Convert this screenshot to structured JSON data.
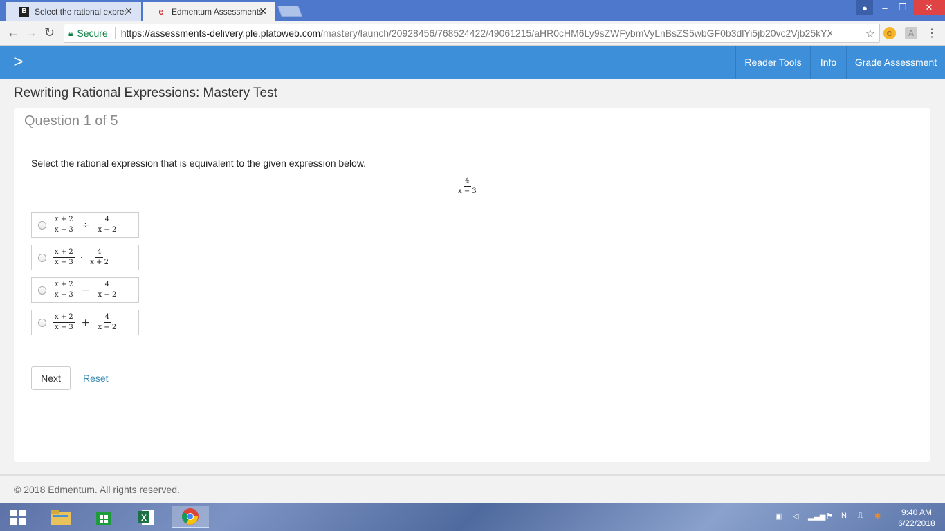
{
  "browser": {
    "tabs": [
      {
        "title": "Select the rational expres",
        "favicon": "B",
        "active": false
      },
      {
        "title": "Edmentum Assessments",
        "favicon": "e",
        "active": true
      }
    ],
    "secure_label": "Secure",
    "url_host": "https://assessments-delivery.ple.platoweb.com",
    "url_path": "/mastery/launch/20928456/768524422/49061215/aHR0cHM6Ly9sZWFybmVyLnBsZS5wbGF0b3dlYi5jb20vc2Vjb25kYXJ5L25kYXJ5L2xl..."
  },
  "header": {
    "reader_tools": "Reader Tools",
    "info": "Info",
    "grade": "Grade Assessment",
    "accent": "#3d8fd9"
  },
  "test_title": "Rewriting Rational Expressions: Mastery Test",
  "question": {
    "number": "Question 1 of 5",
    "prompt": "Select the rational expression that is equivalent to the given expression below.",
    "given": {
      "num": "4",
      "den": "x − 3"
    },
    "options": [
      {
        "left_num": "x + 2",
        "left_den": "x − 3",
        "op": "÷",
        "right_num": "4",
        "right_den": "x + 2"
      },
      {
        "left_num": "x + 2",
        "left_den": "x − 3",
        "op": "·",
        "right_num": "4",
        "right_den": "x + 2"
      },
      {
        "left_num": "x + 2",
        "left_den": "x − 3",
        "op": "−",
        "right_num": "4",
        "right_den": "x + 2"
      },
      {
        "left_num": "x + 2",
        "left_den": "x − 3",
        "op": "+",
        "right_num": "4",
        "right_den": "x + 2"
      }
    ]
  },
  "buttons": {
    "next": "Next",
    "reset": "Reset"
  },
  "footer": "© 2018 Edmentum. All rights reserved.",
  "taskbar": {
    "time": "9:40 AM",
    "date": "6/22/2018"
  }
}
